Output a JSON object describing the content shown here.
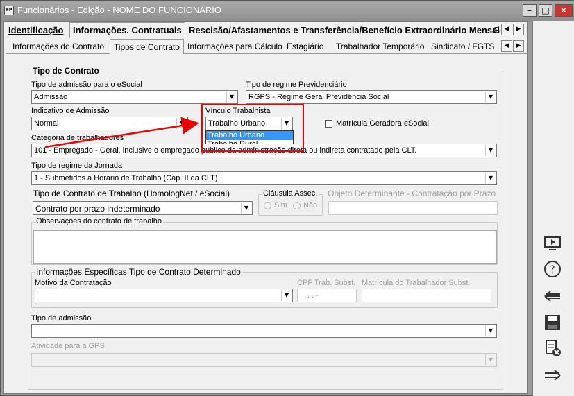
{
  "window": {
    "icon": "FP",
    "title": "Funcionários - Edição - NOME DO FUNCIONÁRIO",
    "minimize_icon": "minimize-icon",
    "maximize_icon": "maximize-icon",
    "close_icon": "close-icon"
  },
  "main_tabs": [
    {
      "label": "Identificação"
    },
    {
      "label": "Informações. Contratuais"
    },
    {
      "label": "Rescisão/Afastamentos e Transferência/Benefício Extraordinário Mensal"
    },
    {
      "label": "G"
    }
  ],
  "sub_tabs": [
    {
      "label": "Informações do Contrato"
    },
    {
      "label": "Tipos de Contrato"
    },
    {
      "label": "Informações para Cálculo"
    },
    {
      "label": "Estagiário"
    },
    {
      "label": "Trabalhador Temporário"
    },
    {
      "label": "Sindicato / FGTS"
    }
  ],
  "form": {
    "group_title": "Tipo de Contrato",
    "tipo_admissao_esocial": {
      "label": "Tipo de admissão para o eSocial",
      "value": "Admissão"
    },
    "regime_previdenciario": {
      "label": "Tipo de regime Previdenciário",
      "value": "RGPS - Regime Geral Previdência Social"
    },
    "indicativo_admissao": {
      "label": "Indicativo de Admissão",
      "value": "Normal"
    },
    "vinculo": {
      "label": "Vínculo Trabalhista",
      "value": "Trabalho Urbano",
      "options": [
        "Trabalho Urbano",
        "Trabalho Rural"
      ]
    },
    "matricula": {
      "label": "Matrícula Geradora eSocial",
      "checked": false
    },
    "categoria": {
      "label": "Categoria de trabalhadores",
      "value": "101 - Empregado - Geral, inclusive o empregado público da administração direta ou indireta contratado pela CLT."
    },
    "jornada": {
      "label": "Tipo de regime da Jornada",
      "value": "1 - Submetidos a Horário de Trabalho (Cap. II da CLT)"
    },
    "contrato_trabalho": {
      "label": "Tipo de Contrato de Trabalho (HomologNet / eSocial)",
      "value": "Contrato por prazo indeterminado"
    },
    "clausula": {
      "label": "Cláusula Assec.",
      "sim": "Sim",
      "nao": "Não"
    },
    "objeto": {
      "label": "Objeto Determinante - Contratação por Prazo"
    },
    "observacoes": {
      "label": "Observações do contrato de trabalho"
    },
    "info_especificas": {
      "label": "Informações Específicas Tipo de Contrato Determinado",
      "motivo": "Motivo da Contratação",
      "cpf": "CPF Trab. Subst.",
      "cpf_mask": ". . -",
      "matricula_subst": "Matrícula do Trabalhador Subst."
    },
    "tipo_admissao": {
      "label": "Tipo de admissão"
    },
    "atividade_gps": {
      "label": "Atividade para a GPS"
    }
  },
  "annotation_color": "#e00000",
  "sidebar": [
    "monitor-icon",
    "help-icon",
    "back-arrow-icon",
    "save-icon",
    "cancel-document-icon",
    "forward-arrow-icon"
  ]
}
